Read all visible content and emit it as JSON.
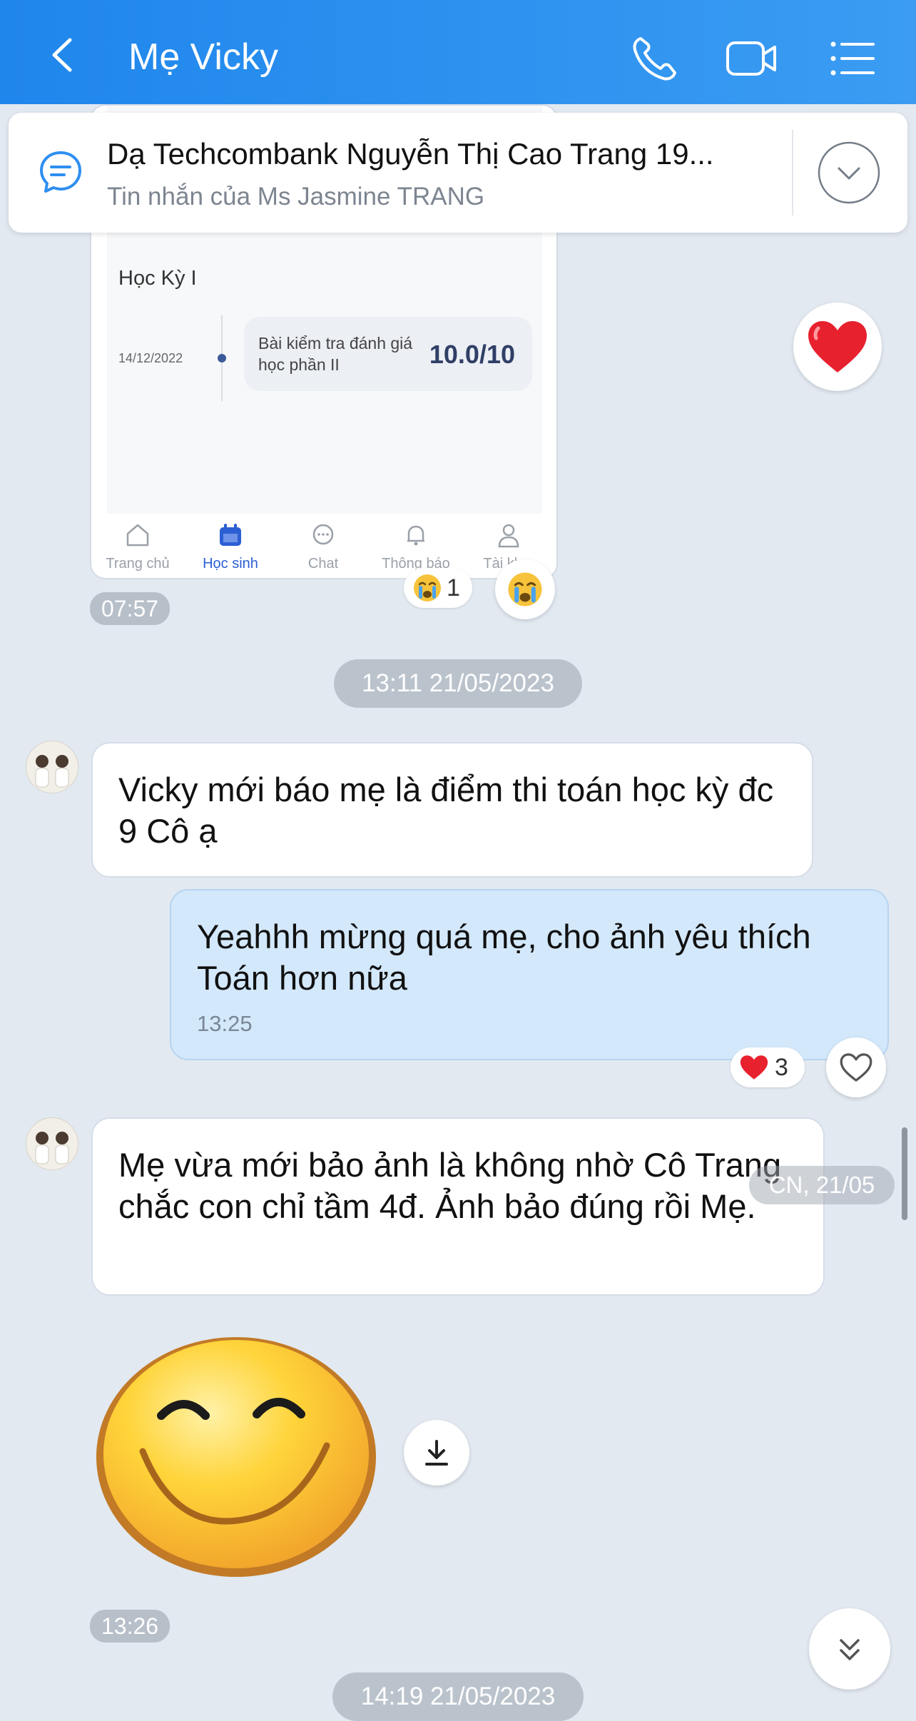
{
  "header": {
    "title": "Mẹ Vicky",
    "background": "#2a8ff0",
    "icons": [
      "back-arrow-icon",
      "phone-icon",
      "video-call-icon",
      "menu-list-icon"
    ]
  },
  "pinned": {
    "title": "Dạ Techcombank Nguyễn Thị Cao Trang 19...",
    "subtitle": "Tin nhắn của Ms Jasmine TRANG"
  },
  "image_message": {
    "term_label": "Học Kỳ I",
    "date": "14/12/2022",
    "test_name": "Bài kiểm tra đánh giá học phần II",
    "score": "10.0/10",
    "tabs": [
      {
        "label": "Trang chủ",
        "icon": "home-icon"
      },
      {
        "label": "Học sinh",
        "icon": "calendar-icon"
      },
      {
        "label": "Chat",
        "icon": "chat-bubble-icon"
      },
      {
        "label": "Thông báo",
        "icon": "bell-icon"
      },
      {
        "label": "Tài kh...",
        "icon": "person-icon"
      }
    ],
    "reaction_count": "1",
    "time": "07:57"
  },
  "date_separator_1": "13:11 21/05/2023",
  "messages": [
    {
      "text": "Vicky mới báo mẹ là điểm thi toán học kỳ đc 9 Cô ạ"
    },
    {
      "text": "Yeahhh mừng quá mẹ, cho ảnh yêu thích Toán hơn nữa",
      "time": "13:25",
      "reaction_count": "3"
    },
    {
      "text": "Mẹ vừa mới bảo ảnh là không nhờ Cô Trang chắc con chỉ tầm 4đ. Ảnh bảo đúng rồi Mẹ."
    }
  ],
  "sticker_time": "13:26",
  "date_separator_2": "14:19 21/05/2023",
  "floating_date": "CN, 21/05",
  "colors": {
    "background": "#e2e9f1",
    "my_bubble": "#d3e8fb",
    "accent": "#2c5fd4",
    "heart": "#e8212e"
  }
}
